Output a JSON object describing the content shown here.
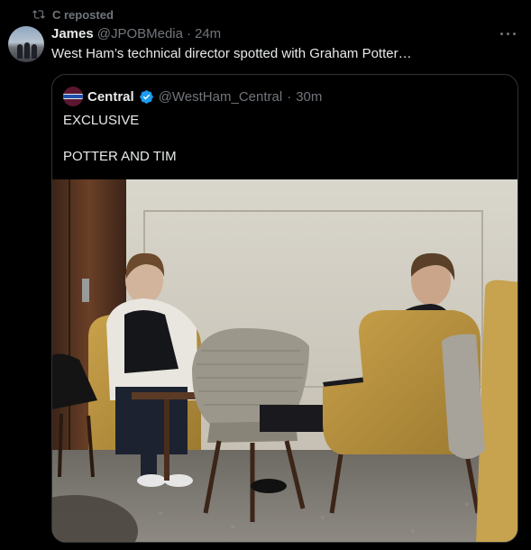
{
  "repost": {
    "label": "C reposted"
  },
  "post": {
    "author_name": "James",
    "author_handle": "@JPOBMedia",
    "separator": "·",
    "time": "24m",
    "text": "West Ham’s technical director spotted with Graham Potter…",
    "more_label": "···"
  },
  "quote": {
    "author_name": "Central",
    "author_handle": "@WestHam_Central",
    "separator": "·",
    "time": "30m",
    "line1": "EXCLUSIVE",
    "line2": "POTTER AND TIM"
  },
  "colors": {
    "background": "#000000",
    "text_primary": "#e7e9ea",
    "text_secondary": "#71767b",
    "border": "#2f3336",
    "verified": "#1d9bf0"
  }
}
